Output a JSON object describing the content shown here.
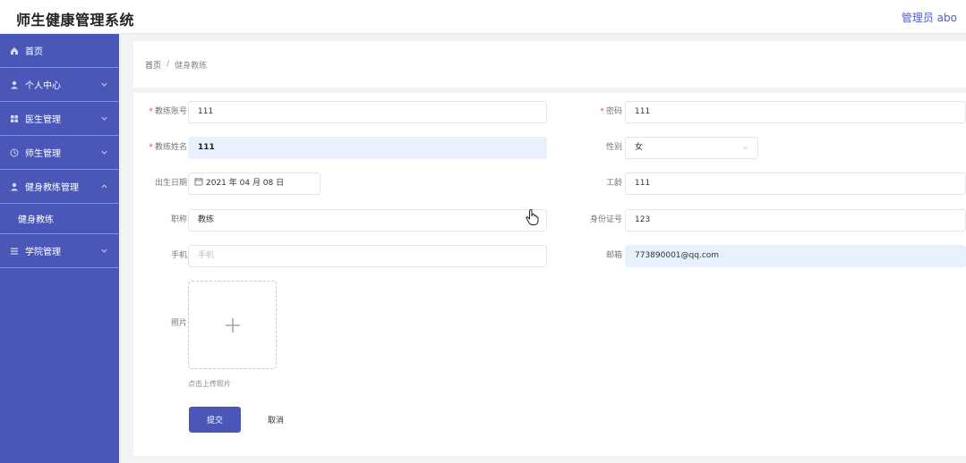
{
  "header": {
    "title": "师生健康管理系统",
    "user": "管理员 abo"
  },
  "sidebar": {
    "items": [
      {
        "label": "首页",
        "icon": "home-icon"
      },
      {
        "label": "个人中心",
        "icon": "user-icon"
      },
      {
        "label": "医生管理",
        "icon": "grid-icon"
      },
      {
        "label": "师生管理",
        "icon": "clock-icon"
      },
      {
        "label": "健身教练管理",
        "icon": "user-icon"
      },
      {
        "label": "学院管理",
        "icon": "list-icon"
      }
    ],
    "subitem": "健身教练"
  },
  "breadcrumb": {
    "home": "首页",
    "separator": "/",
    "current": "健身教练"
  },
  "form": {
    "account": {
      "label": "教练账号",
      "value": "111"
    },
    "password": {
      "label": "密码",
      "value": "111"
    },
    "name": {
      "label": "教练姓名",
      "value": "111"
    },
    "gender": {
      "label": "性别",
      "value": "女"
    },
    "birth": {
      "label": "出生日期",
      "value": "2021 年 04 月 08 日"
    },
    "seniority": {
      "label": "工龄",
      "value": "111"
    },
    "title": {
      "label": "职称",
      "value": "教练"
    },
    "id_card": {
      "label": "身份证号",
      "value": "123"
    },
    "phone": {
      "label": "手机",
      "placeholder": "手机"
    },
    "email": {
      "label": "邮箱",
      "value": "773890001@qq.com"
    },
    "photo": {
      "label": "照片",
      "hint": "点击上传照片"
    },
    "required_mark": "*",
    "submit": "提交",
    "cancel": "取消"
  },
  "colors": {
    "accent": "#4b57b6",
    "autofill": "#e8f0fe",
    "required": "#e64a4a"
  }
}
